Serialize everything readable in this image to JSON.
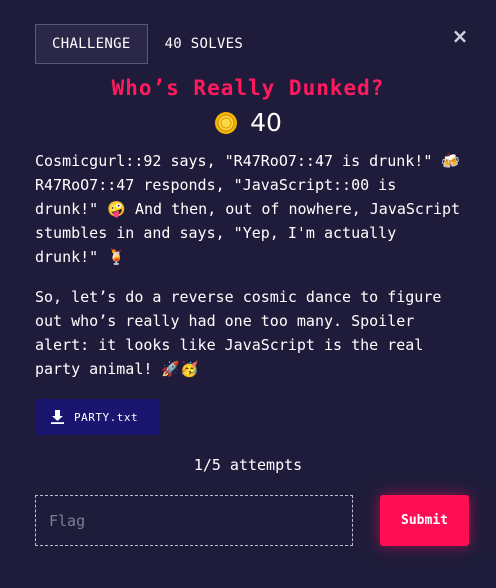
{
  "tabs": {
    "challenge_label": "CHALLENGE",
    "solves_label": "40 SOLVES"
  },
  "close_glyph": "×",
  "challenge": {
    "title": "Who’s Really Dunked?",
    "points": "40",
    "description": [
      "Cosmicgurl::92 says, \"R47RoO7::47 is drunk!\" 🍻 R47RoO7::47 responds, \"JavaScript::00 is drunk!\" 🤪 And then, out of nowhere, JavaScript stumbles in and says, \"Yep, I'm actually drunk!\" 🍹",
      "So, let’s do a reverse cosmic dance to figure out who’s really had one too many. Spoiler alert: it looks like JavaScript is the real party animal! 🚀🥳"
    ],
    "file_name": "PARTY.txt",
    "attempts": "1/5 attempts"
  },
  "form": {
    "flag_placeholder": "Flag",
    "flag_value": "",
    "submit_label": "Submit"
  },
  "colors": {
    "background": "#1f1c3b",
    "title": "#ff1a5e",
    "submit": "#ff0d55",
    "file_button": "#1a1670"
  },
  "icons": {
    "points": "coin-icon",
    "file": "download-icon",
    "close": "close-icon"
  }
}
